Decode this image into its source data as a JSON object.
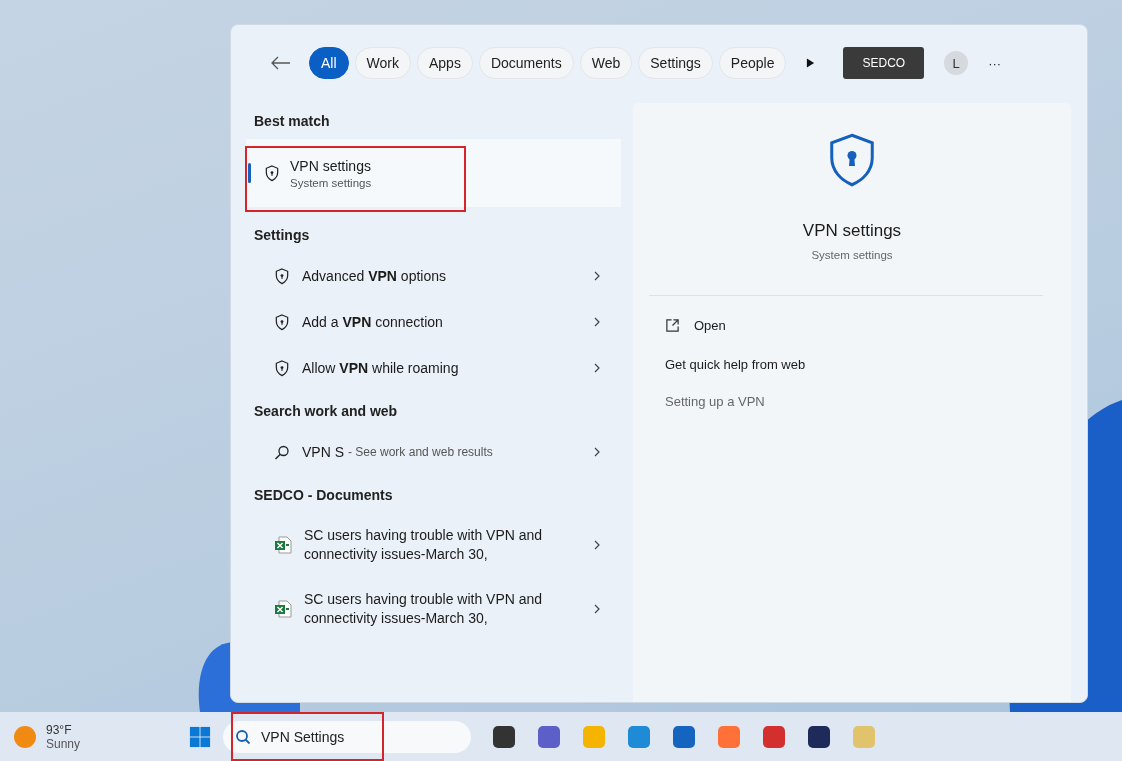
{
  "filters": [
    {
      "label": "All",
      "selected": true
    },
    {
      "label": "Work",
      "selected": false
    },
    {
      "label": "Apps",
      "selected": false
    },
    {
      "label": "Documents",
      "selected": false
    },
    {
      "label": "Web",
      "selected": false
    },
    {
      "label": "Settings",
      "selected": false
    },
    {
      "label": "People",
      "selected": false
    }
  ],
  "org_button": "SEDCO",
  "account_initial": "L",
  "more_button": "···",
  "best_match": {
    "heading": "Best match",
    "title": "VPN settings",
    "subtitle": "System settings",
    "selected": true
  },
  "settings": {
    "heading": "Settings",
    "items": [
      "Advanced **VPN** options",
      "Add a **VPN** connection",
      "Allow **VPN** while roaming"
    ]
  },
  "web": {
    "heading": "Search work and web",
    "query": "VPN S",
    "hint": "- See work and web results"
  },
  "documents": {
    "heading": "SEDCO - Documents",
    "items": [
      "SC users having trouble with VPN and connectivity issues-March 30,",
      "SC users having trouble with VPN and connectivity issues-March 30,"
    ]
  },
  "preview": {
    "title": "VPN settings",
    "subtitle": "System settings",
    "open": "Open",
    "help_heading": "Get quick help from web",
    "help_links": [
      "Setting up a VPN"
    ]
  },
  "taskbar": {
    "temperature": "93°F",
    "condition": "Sunny",
    "search_value": "VPN Settings"
  }
}
